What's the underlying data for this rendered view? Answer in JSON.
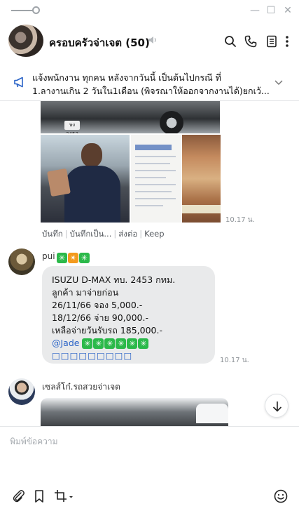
{
  "window": {
    "minimize": "—",
    "maximize": "☐",
    "close": "✕"
  },
  "header": {
    "title": "ครอบครัวจ่าเจต (50)"
  },
  "announcement": {
    "line1": "แจ้งพนักงาน ทุกคน หลังจากวันนี้ เป็นต้นไปกรณี ที่",
    "line2": "1.ลางานเกิน 2 วันใน1เดือน (พิจรณาให้ออกจากงานได้)ยกเว้..."
  },
  "messages": {
    "photo_time": "10.17 น.",
    "plate": "ษง 2453",
    "actions": [
      "บันทึก",
      "บันทึกเป็น...",
      "ส่งต่อ",
      "Keep"
    ],
    "pui": {
      "name": "pui",
      "lines": [
        "ISUZU D-MAX ทบ. 2453 กทม.",
        "ลูกค้า มาจ่ายก่อน",
        "26/11/66 จอง 5,000.-",
        "18/12/66 จ่าย 90,000.-",
        "เหลือจ่ายวันรับรถ 185,000.-"
      ],
      "mention": "@Jade",
      "placeholders": "□□□□□□□□□",
      "time": "10.17 น."
    },
    "sale": {
      "name": "เซลส์โก๋.รถสวยจ่าเจต"
    }
  },
  "composer": {
    "placeholder": "พิมพ์ข้อความ"
  }
}
